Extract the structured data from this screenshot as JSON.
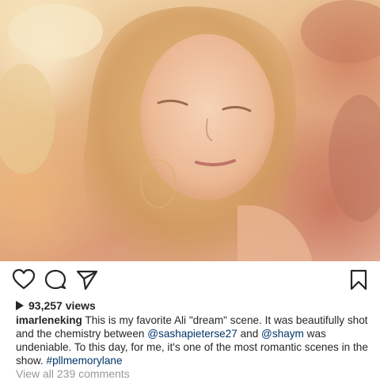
{
  "post": {
    "image_alt": "Blonde young woman in a warm, sepia-toned dreamy scene",
    "views_count": "93,257 views",
    "caption": {
      "username": "imarleneking",
      "text_1": "This is my favorite Ali \"dream\" scene.  It was beautifully shot and the chemistry between ",
      "mention_1": "@sashapieterse27",
      "text_2": " and ",
      "mention_2": "@shaym",
      "text_3": " was undeniable.  To this day, for me, it's one of the most romantic scenes in the show. ",
      "hashtag": "#pllmemorylane"
    },
    "view_comments": "View all 239 comments"
  },
  "icons": {
    "like": "heart-icon",
    "comment": "comment-bubble-icon",
    "share": "paper-plane-icon",
    "save": "bookmark-icon",
    "views": "play-icon"
  },
  "colors": {
    "text": "#262626",
    "link": "#003569",
    "muted": "#999999"
  }
}
